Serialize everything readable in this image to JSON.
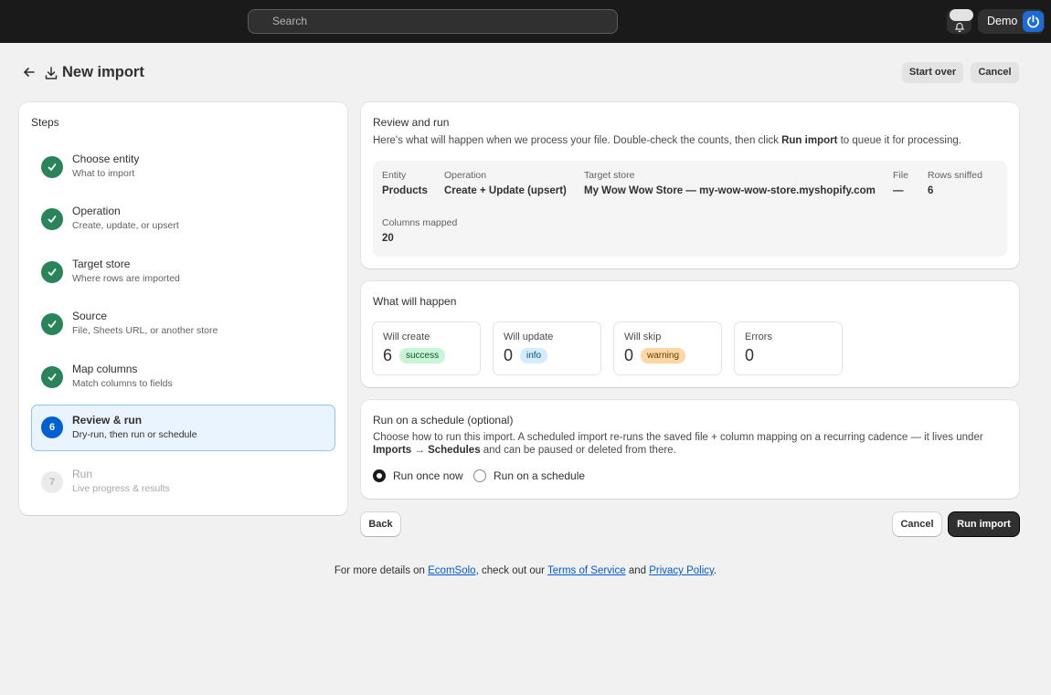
{
  "topbar": {
    "search_placeholder": "Search",
    "user_name": "Demo"
  },
  "header": {
    "title": "New import",
    "start_over_label": "Start over",
    "cancel_label": "Cancel"
  },
  "steps": {
    "title": "Steps",
    "items": [
      {
        "title": "Choose entity",
        "subtitle": "What to import",
        "status": "done"
      },
      {
        "title": "Operation",
        "subtitle": "Create, update, or upsert",
        "status": "done"
      },
      {
        "title": "Target store",
        "subtitle": "Where rows are imported",
        "status": "done"
      },
      {
        "title": "Source",
        "subtitle": "File, Sheets URL, or another store",
        "status": "done"
      },
      {
        "title": "Map columns",
        "subtitle": "Match columns to fields",
        "status": "done"
      },
      {
        "number": "6",
        "title": "Review & run",
        "subtitle": "Dry-run, then run or schedule",
        "status": "active"
      },
      {
        "number": "7",
        "title": "Run",
        "subtitle": "Live progress & results",
        "status": "pending"
      }
    ]
  },
  "review": {
    "heading": "Review and run",
    "desc_before": "Here's what will happen when we process your file. Double-check the counts, then click ",
    "desc_bold": "Run import",
    "desc_after": " to queue it for processing.",
    "summary": {
      "entity_label": "Entity",
      "entity_value": "Products",
      "operation_label": "Operation",
      "operation_value": "Create + Update (upsert)",
      "store_label": "Target store",
      "store_value": "My Wow Wow Store — my-wow-wow-store.myshopify.com",
      "file_label": "File",
      "file_value": "—",
      "rows_label": "Rows sniffed",
      "rows_value": "6",
      "columns_label": "Columns mapped",
      "columns_value": "20"
    }
  },
  "happen": {
    "heading": "What will happen",
    "stats": [
      {
        "label": "Will create",
        "value": "6",
        "badge": "success"
      },
      {
        "label": "Will update",
        "value": "0",
        "badge": "info"
      },
      {
        "label": "Will skip",
        "value": "0",
        "badge": "warning"
      },
      {
        "label": "Errors",
        "value": "0",
        "badge": ""
      }
    ]
  },
  "schedule": {
    "heading": "Run on a schedule (optional)",
    "desc_line1": "Choose how to run this import. A scheduled import re-runs the saved file + column mapping on a recurring cadence — it lives under",
    "desc_bold1": "Imports",
    "desc_arrow": " → ",
    "desc_bold2": "Schedules",
    "desc_after": " and can be paused or deleted from there.",
    "option_once": "Run once now",
    "option_schedule": "Run on a schedule",
    "selected": "once"
  },
  "actions": {
    "back_label": "Back",
    "cancel_label": "Cancel",
    "run_label": "Run import"
  },
  "footer": {
    "prefix": "For more details on ",
    "brand_link": "EcomSolo",
    "middle": ", check out our ",
    "terms_link": "Terms of Service",
    "and": " and ",
    "privacy_link": "Privacy Policy",
    "suffix": "."
  },
  "colors": {
    "topbar": "#1a1a1a",
    "step_done": "#29845a",
    "step_active": "#0060d1",
    "primary_button": "#303030",
    "link": "#005bd3"
  }
}
